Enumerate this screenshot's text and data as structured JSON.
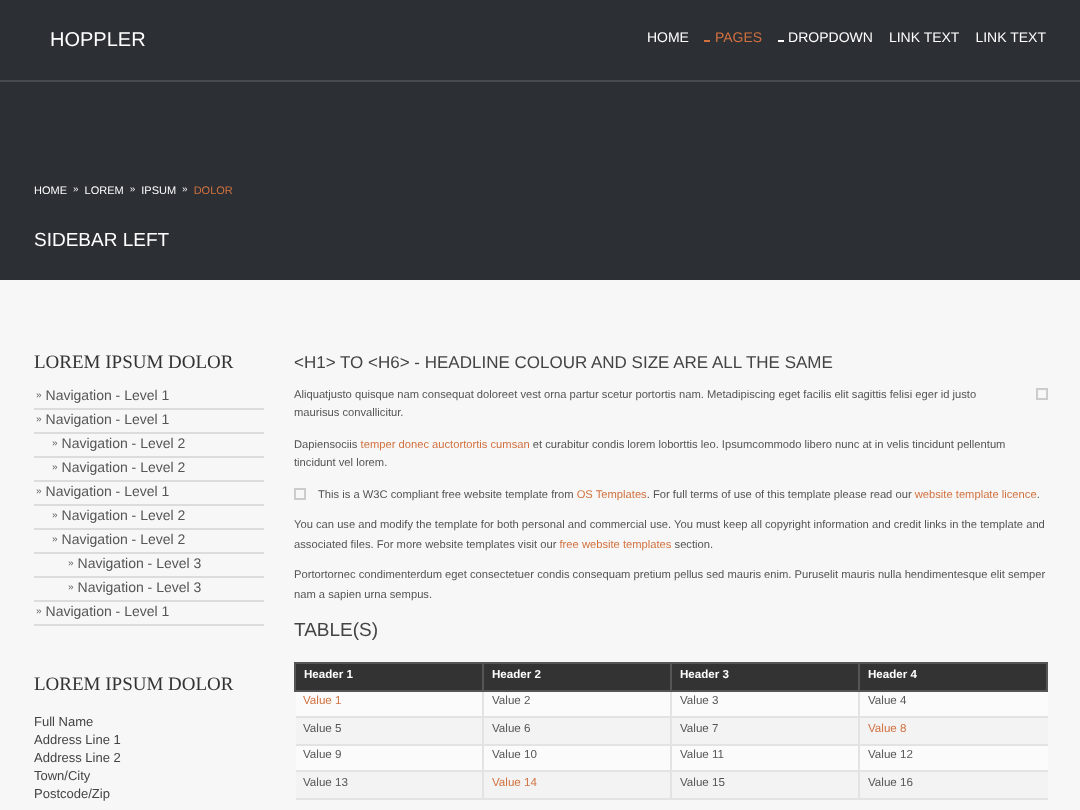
{
  "header": {
    "logo": "HOPPLER",
    "nav": [
      {
        "label": "HOME",
        "selected": false,
        "dropdown": false
      },
      {
        "label": "PAGES",
        "selected": true,
        "dropdown": true
      },
      {
        "label": "DROPDOWN",
        "selected": false,
        "dropdown": true
      },
      {
        "label": "LINK TEXT",
        "selected": false,
        "dropdown": false
      },
      {
        "label": "LINK TEXT",
        "selected": false,
        "dropdown": false
      }
    ]
  },
  "breadcrumb": {
    "separator": "»",
    "items": [
      {
        "label": "HOME",
        "selected": false
      },
      {
        "label": "LOREM",
        "selected": false
      },
      {
        "label": "IPSUM",
        "selected": false
      },
      {
        "label": "DOLOR",
        "selected": true
      }
    ]
  },
  "page_title": "SIDEBAR LEFT",
  "sidebar": {
    "bullet": "»",
    "nav_heading": "LOREM IPSUM DOLOR",
    "nav": [
      {
        "label": "Navigation - Level 1"
      },
      {
        "label": "Navigation - Level 1",
        "children": [
          {
            "label": "Navigation - Level 2"
          },
          {
            "label": "Navigation - Level 2"
          }
        ]
      },
      {
        "label": "Navigation - Level 1",
        "children": [
          {
            "label": "Navigation - Level 2"
          },
          {
            "label": "Navigation - Level 2",
            "children": [
              {
                "label": "Navigation - Level 3"
              },
              {
                "label": "Navigation - Level 3"
              }
            ]
          }
        ]
      },
      {
        "label": "Navigation - Level 1"
      }
    ],
    "address_heading": "LOREM IPSUM DOLOR",
    "address": [
      "Full Name",
      "Address Line 1",
      "Address Line 2",
      "Town/City",
      "Postcode/Zip"
    ]
  },
  "main": {
    "heading": "<H1> TO <H6> - HEADLINE COLOUR AND SIZE ARE ALL THE SAME",
    "paragraphs": [
      {
        "kind": "trailing",
        "parts": [
          {
            "kind": "text",
            "text": "Aliquatjusto quisque nam consequat doloreet vest orna partur scetur portortis nam. Metadipiscing eget facilis elit sagittis felisi eger id justo maurisus convallicitur."
          }
        ]
      },
      {
        "kind": "plain",
        "parts": [
          {
            "kind": "text",
            "text": "Dapiensociis "
          },
          {
            "kind": "link",
            "text": "temper donec auctortortis cumsan"
          },
          {
            "kind": "text",
            "text": " et curabitur condis lorem loborttis leo. Ipsumcommodo libero nunc at in velis tincidunt pellentum tincidunt vel lorem."
          }
        ]
      },
      {
        "kind": "leading",
        "parts": [
          {
            "kind": "text",
            "text": "This is a W3C compliant free website template from "
          },
          {
            "kind": "link",
            "text": "OS Templates"
          },
          {
            "kind": "text",
            "text": ". For full terms of use of this template please read our "
          },
          {
            "kind": "link",
            "text": "website template licence"
          },
          {
            "kind": "text",
            "text": "."
          }
        ]
      },
      {
        "kind": "plain",
        "parts": [
          {
            "kind": "text",
            "text": "You can use and modify the template for both personal and commercial use. You must keep all copyright information and credit links in the template and associated files. For more website templates visit our "
          },
          {
            "kind": "link",
            "text": "free website templates"
          },
          {
            "kind": "text",
            "text": " section."
          }
        ]
      },
      {
        "kind": "plain",
        "parts": [
          {
            "kind": "text",
            "text": "Portortornec condimenterdum eget consectetuer condis consequam pretium pellus sed mauris enim. Puruselit mauris nulla hendimentesque elit semper nam a sapien urna sempus."
          }
        ]
      }
    ],
    "table_heading": "TABLE(S)",
    "table": {
      "columns": [
        "Header 1",
        "Header 2",
        "Header 3",
        "Header 4"
      ],
      "rows": [
        [
          {
            "text": "Value 1",
            "link": true
          },
          {
            "text": "Value 2",
            "link": false
          },
          {
            "text": "Value 3",
            "link": false
          },
          {
            "text": "Value 4",
            "link": false
          }
        ],
        [
          {
            "text": "Value 5",
            "link": false
          },
          {
            "text": "Value 6",
            "link": false
          },
          {
            "text": "Value 7",
            "link": false
          },
          {
            "text": "Value 8",
            "link": true
          }
        ],
        [
          {
            "text": "Value 9",
            "link": false
          },
          {
            "text": "Value 10",
            "link": false
          },
          {
            "text": "Value 11",
            "link": false
          },
          {
            "text": "Value 12",
            "link": false
          }
        ],
        [
          {
            "text": "Value 13",
            "link": false
          },
          {
            "text": "Value 14",
            "link": true
          },
          {
            "text": "Value 15",
            "link": false
          },
          {
            "text": "Value 16",
            "link": false
          }
        ]
      ]
    }
  }
}
